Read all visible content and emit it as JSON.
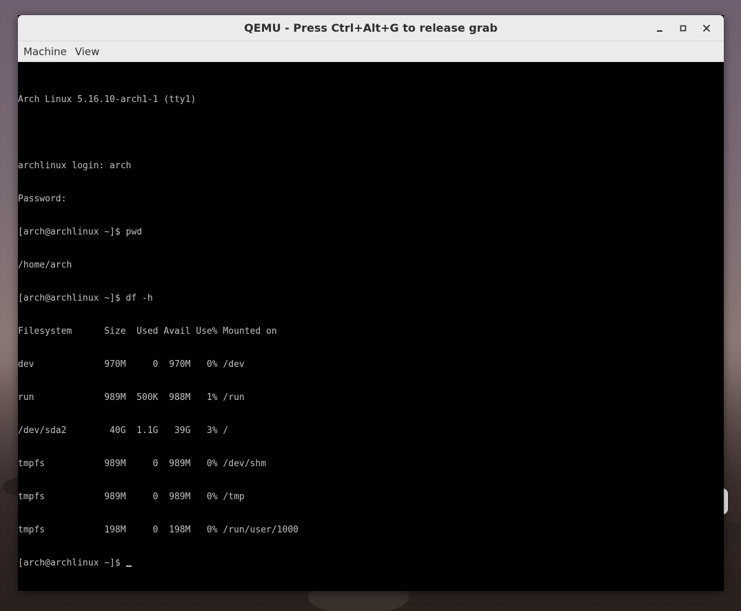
{
  "window": {
    "title": "QEMU - Press Ctrl+Alt+G to release grab",
    "controls": {
      "minimize": "minimize-icon",
      "maximize": "maximize-icon",
      "close": "close-icon"
    }
  },
  "menubar": {
    "items": [
      "Machine",
      "View"
    ]
  },
  "console": {
    "lines": [
      "Arch Linux 5.16.10-arch1-1 (tty1)",
      "",
      "archlinux login: arch",
      "Password:",
      "[arch@archlinux ~]$ pwd",
      "/home/arch",
      "[arch@archlinux ~]$ df -h",
      "Filesystem      Size  Used Avail Use% Mounted on",
      "dev             970M     0  970M   0% /dev",
      "run             989M  500K  988M   1% /run",
      "/dev/sda2        40G  1.1G   39G   3% /",
      "tmpfs           989M     0  989M   0% /dev/shm",
      "tmpfs           989M     0  989M   0% /tmp",
      "tmpfs           198M     0  198M   0% /run/user/1000"
    ],
    "prompt": "[arch@archlinux ~]$ "
  },
  "colors": {
    "console_text": "#c0c0c0",
    "console_bg": "#000000",
    "titlebar_bg": "#ebebeb"
  }
}
